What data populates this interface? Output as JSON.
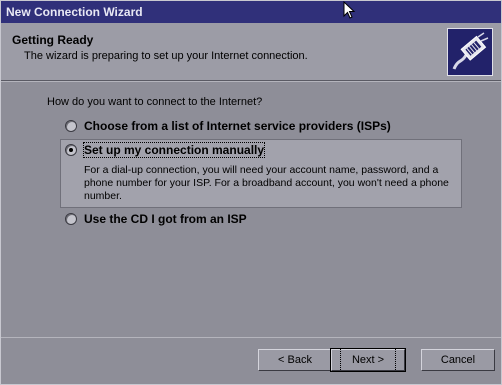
{
  "window": {
    "title": "New Connection Wizard"
  },
  "header": {
    "title": "Getting Ready",
    "subtitle": "The wizard is preparing to set up your Internet connection.",
    "icon": "network-cable-icon"
  },
  "main": {
    "question": "How do you want to connect to the Internet?",
    "options": [
      {
        "label": "Choose from a list of Internet service providers (ISPs)",
        "selected": false
      },
      {
        "label": "Set up my connection manually",
        "selected": true,
        "description": "For a dial-up connection, you will need your account name, password, and a phone number for your ISP. For a broadband account, you won't need a phone number."
      },
      {
        "label": "Use the CD I got from an ISP",
        "selected": false
      }
    ]
  },
  "footer": {
    "back_label": "< Back",
    "next_label": "Next >",
    "cancel_label": "Cancel"
  },
  "colors": {
    "titlebar": "#30307a",
    "header_bg": "#9c9ca6",
    "body_bg": "#8e8e98",
    "icon_bg": "#22226a"
  }
}
